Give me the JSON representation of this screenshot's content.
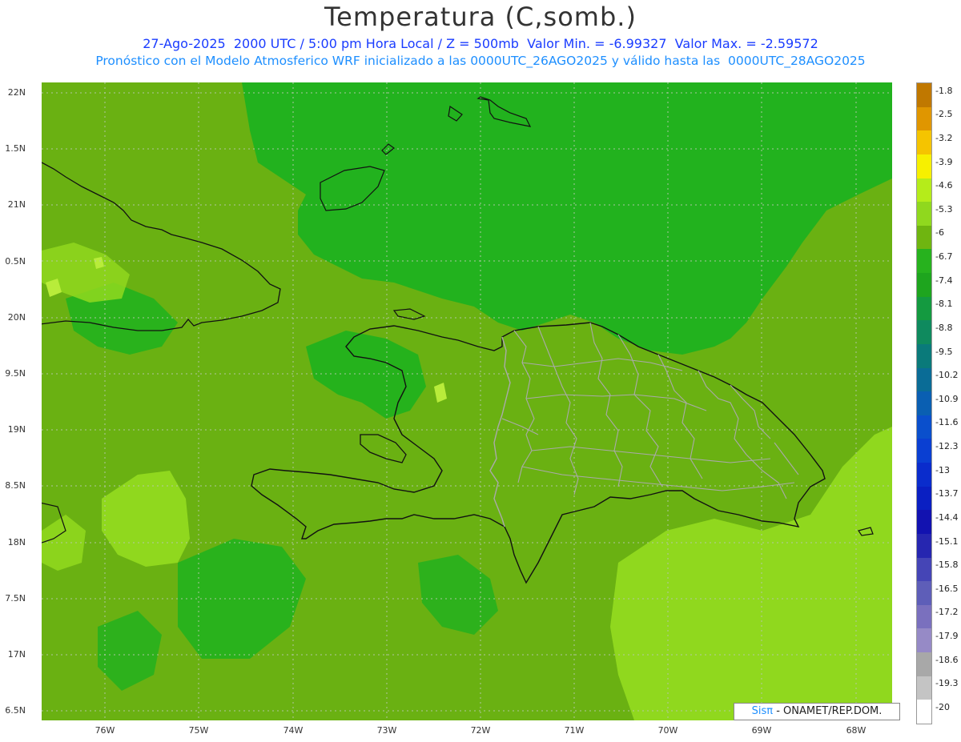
{
  "title": "Temperatura (C,somb.)",
  "subtitle_line1": "27-Ago-2025  2000 UTC / 5:00 pm Hora Local / Z = 500mb  Valor Min. = -6.99327  Valor Max. = -2.59572",
  "subtitle_line2": "Pronóstico con el Modelo Atmosferico WRF inicializado a las 0000UTC_26AGO2025 y válido hasta las  0000UTC_28AGO2025",
  "y_axis_labels": [
    "22N",
    "1.5N",
    "21N",
    "0.5N",
    "20N",
    "9.5N",
    "19N",
    "8.5N",
    "18N",
    "7.5N",
    "17N",
    "6.5N"
  ],
  "x_axis_labels": [
    "76W",
    "75W",
    "74W",
    "73W",
    "72W",
    "71W",
    "70W",
    "69W",
    "68W"
  ],
  "colorbar": {
    "labels": [
      "-1.8",
      "-2.5",
      "-3.2",
      "-3.9",
      "-4.6",
      "-5.3",
      "-6",
      "-6.7",
      "-7.4",
      "-8.1",
      "-8.8",
      "-9.5",
      "-10.2",
      "-10.9",
      "-11.6",
      "-12.3",
      "-13",
      "-13.7",
      "-14.4",
      "-15.1",
      "-15.8",
      "-16.5",
      "-17.2",
      "-17.9",
      "-18.6",
      "-19.3",
      "-20"
    ],
    "colors": [
      "#c07800",
      "#e09600",
      "#f5c400",
      "#f7f000",
      "#b5ec1a",
      "#90d81e",
      "#6fb510",
      "#27b21e",
      "#1ea51e",
      "#149a40",
      "#0f8a5e",
      "#0a7a7a",
      "#0a6c96",
      "#0a5fb2",
      "#0a4fcc",
      "#0a3fd2",
      "#0a2ccc",
      "#0a1fc2",
      "#1212b0",
      "#2626b0",
      "#4545b6",
      "#5e5eb8",
      "#7a70be",
      "#968ac6",
      "#a8a8a8",
      "#c4c4c4",
      "#ffffff"
    ]
  },
  "field_colors": {
    "base": "#6ab112",
    "dark_green": "#22b21e",
    "light_green": "#90d81e",
    "yellow_green": "#b8ec3a"
  },
  "credit": {
    "brand": "Sisπ",
    "text": " - ONAMET/REP.DOM."
  }
}
